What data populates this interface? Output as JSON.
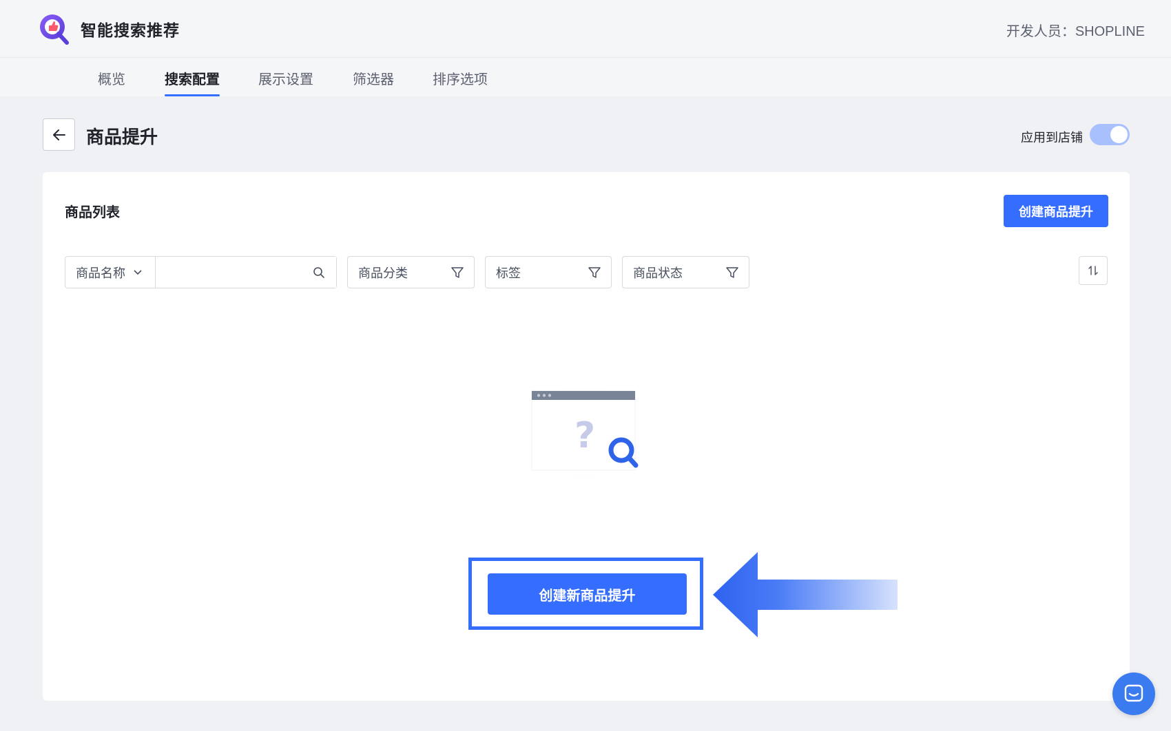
{
  "app": {
    "name": "智能搜索推荐",
    "developer": "开发人员：SHOPLINE"
  },
  "tabs": [
    {
      "label": "概览",
      "active": false
    },
    {
      "label": "搜索配置",
      "active": true
    },
    {
      "label": "展示设置",
      "active": false
    },
    {
      "label": "筛选器",
      "active": false
    },
    {
      "label": "排序选项",
      "active": false
    }
  ],
  "page": {
    "title": "商品提升",
    "apply_label": "应用到店铺",
    "apply_enabled": true
  },
  "card": {
    "title": "商品列表",
    "create_button": "创建商品提升",
    "filters": {
      "name_select": "商品名称",
      "search_value": "",
      "category": "商品分类",
      "tags": "标签",
      "status": "商品状态"
    },
    "empty": {
      "create_new_button": "创建新商品提升"
    }
  },
  "colors": {
    "accent": "#356dff",
    "toggle_on": "#a9c0ff"
  },
  "icons": [
    "back-arrow-icon",
    "chevron-down-icon",
    "search-icon",
    "filter-icon",
    "sort-icon",
    "chat-icon"
  ]
}
